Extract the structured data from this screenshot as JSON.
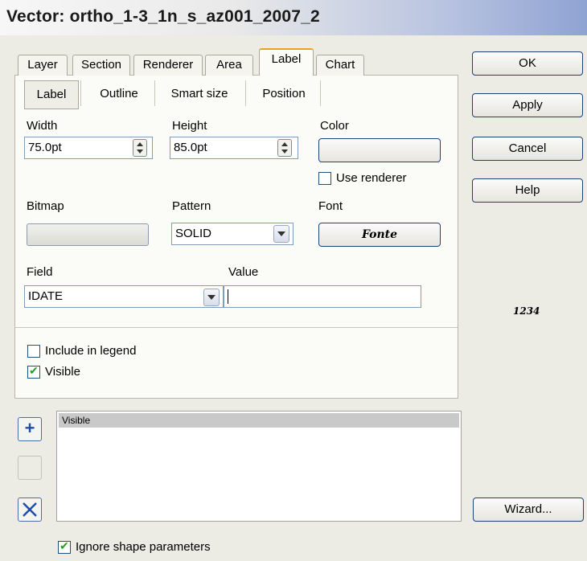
{
  "window": {
    "title": "Vector: ortho_1-3_1n_s_az001_2007_2"
  },
  "tabs": [
    "Layer",
    "Section",
    "Renderer",
    "Area",
    "Label",
    "Chart"
  ],
  "active_tab": "Label",
  "subtabs": [
    "Label",
    "Outline",
    "Smart size",
    "Position"
  ],
  "active_subtab": "Label",
  "form": {
    "width_label": "Width",
    "width_value": "75.0pt",
    "height_label": "Height",
    "height_value": "85.0pt",
    "color_label": "Color",
    "use_renderer_label": "Use renderer",
    "use_renderer_checked": false,
    "bitmap_label": "Bitmap",
    "pattern_label": "Pattern",
    "pattern_value": "SOLID",
    "font_label": "Font",
    "font_button_text": "Fonte",
    "field_label": "Field",
    "field_value": "IDATE",
    "value_label": "Value",
    "value_value": "",
    "include_legend_label": "Include in legend",
    "include_legend_checked": false,
    "visible_label": "Visible",
    "visible_checked": true
  },
  "buttons": {
    "ok": "OK",
    "apply": "Apply",
    "cancel": "Cancel",
    "help": "Help",
    "wizard": "Wizard..."
  },
  "preview_text": "1234",
  "list": {
    "header": "Visible"
  },
  "ignore_shape_label": "Ignore shape parameters",
  "ignore_shape_checked": true,
  "colors": {
    "title_gradient_end": "#8fa3d3",
    "active_tab_accent": "#e9a21a",
    "button_border": "#1f3f7a"
  }
}
